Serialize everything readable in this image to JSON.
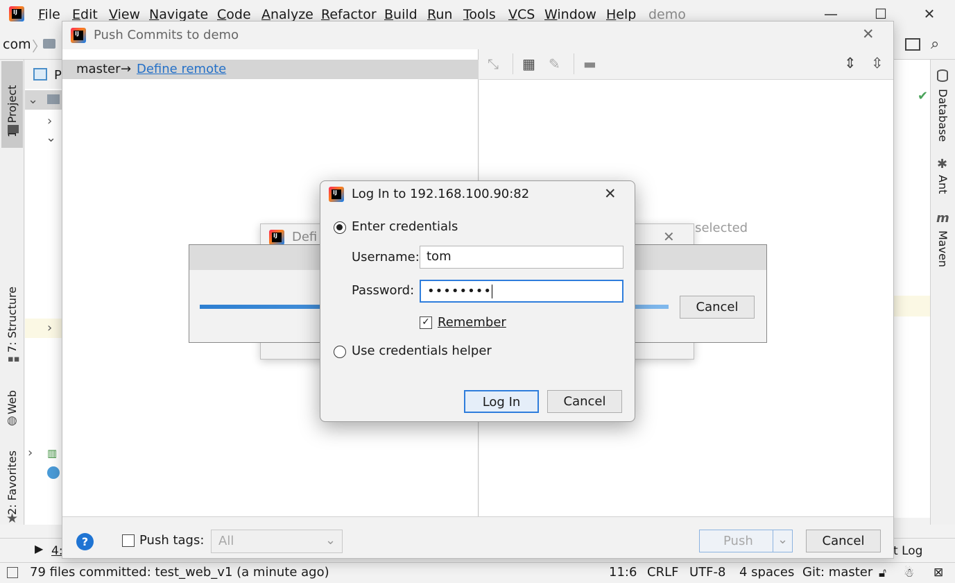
{
  "ide": {
    "menu": [
      "File",
      "Edit",
      "View",
      "Navigate",
      "Code",
      "Analyze",
      "Refactor",
      "Build",
      "Run",
      "Tools",
      "VCS",
      "Window",
      "Help"
    ],
    "project_name": "demo",
    "nav_root": "com",
    "left_tabs": {
      "project": "1: Project",
      "structure": "7: Structure",
      "web": "Web",
      "favorites": "2: Favorites"
    },
    "right_tabs": {
      "database": "Database",
      "ant": "Ant",
      "maven": "Maven"
    },
    "bottom_tab_partial": "4:",
    "bottom_right_partial": "t Log"
  },
  "push_dialog": {
    "title": "Push Commits to demo",
    "branch": "master",
    "arrow": "→",
    "define_remote_link": "Define remote",
    "right_placeholder_partial": "s selected",
    "push_tags_label": "Push tags:",
    "push_tags_select": "All",
    "push_button": "Push",
    "cancel_button": "Cancel",
    "help_icon": "?"
  },
  "define_remote_dialog": {
    "title_partial": "Defi"
  },
  "progress_dialog": {
    "cancel_button": "Cancel",
    "progress": 1.0
  },
  "login_dialog": {
    "title": "Log In to 192.168.100.90:82",
    "enter_credentials_label": "Enter credentials",
    "username_label": "Username:",
    "username_value": "tom",
    "password_label": "Password:",
    "password_value": "••••••••",
    "remember_label": "Remember",
    "remember_checked": true,
    "use_helper_label": "Use credentials helper",
    "login_button": "Log In",
    "cancel_button": "Cancel"
  },
  "status_bar": {
    "message": "79 files committed: test_web_v1 (a minute ago)",
    "position": "11:6",
    "line_sep": "CRLF",
    "encoding": "UTF-8",
    "indent": "4 spaces",
    "git_branch": "Git: master"
  },
  "colors": {
    "accent": "#2e7ddc",
    "link": "#2470c7"
  }
}
